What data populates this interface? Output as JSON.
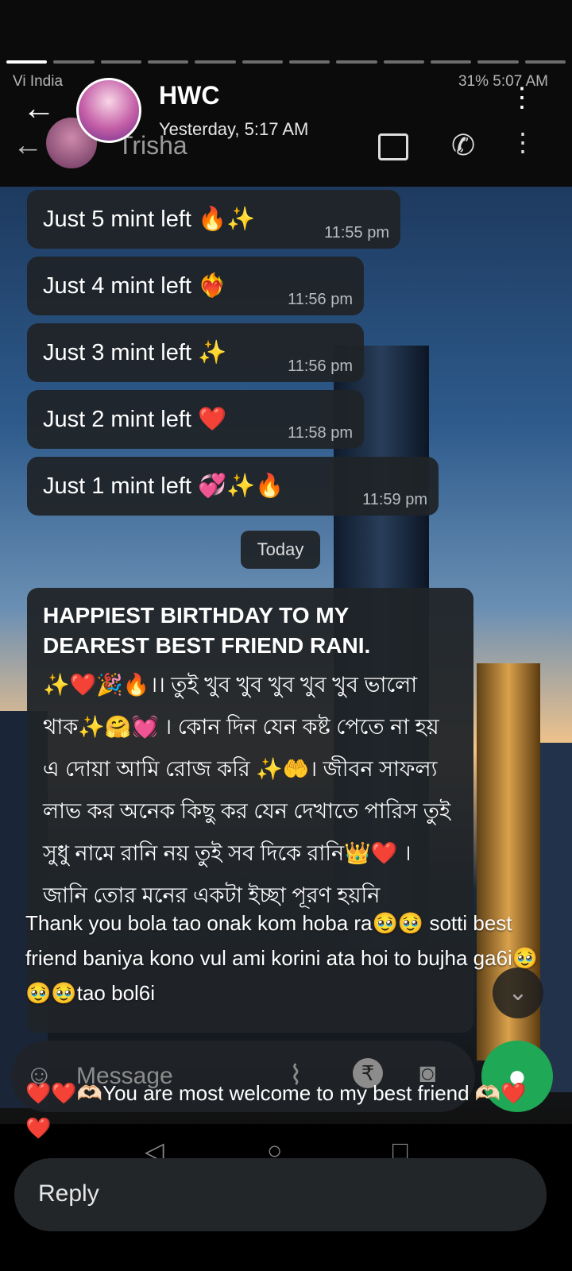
{
  "story": {
    "progress_total": 12,
    "progress_current": 1,
    "title": "HWC",
    "subtitle": "Yesterday, 5:17 AM",
    "status_left": "Vi India",
    "status_right": "31% 5:07 AM",
    "under_name": "Trisha"
  },
  "chat": {
    "messages": [
      {
        "text": "Just 5 mint left 🔥✨",
        "time": "11:55 pm"
      },
      {
        "text": "Just 4 mint left ❤️‍🔥",
        "time": "11:56 pm"
      },
      {
        "text": "Just 3 mint left ✨",
        "time": "11:56 pm"
      },
      {
        "text": "Just 2 mint left ❤️",
        "time": "11:58 pm"
      },
      {
        "text": "Just 1 mint left 💞✨🔥",
        "time": "11:59 pm"
      }
    ],
    "date_chip": "Today",
    "birthday": {
      "heading": "HAPPIEST BIRTHDAY TO MY DEAREST BEST FRIEND RANI.",
      "body": "✨❤️🎉🔥।। তুই খুব খুব খুব খুব খুব ভালো থাক✨🤗💓 । কোন দিন যেন কষ্ট পেতে না হয় এ দোয়া আমি রোজ করি ✨🤲। জীবন সাফল্য লাভ কর অনেক কিছু কর যেন দেখাতে পারিস তুই সুধু নামে রানি নয় তুই সব দিকে রানি👑❤️ । জানি তোর মনের একটা ইচ্ছা পূরণ হয়নি"
    },
    "composer_placeholder": "Message"
  },
  "overlay": {
    "reply_text": "Thank you bola tao onak kom hoba ra🥹🥹 sotti best friend baniya kono vul ami korini ata hoi to bujha ga6i🥹🥹🥹tao bol6i",
    "welcome_text": "❤️❤️🫶🏻You are most welcome to my best friend 🫶🏻❤️❤️"
  },
  "reply_box": {
    "placeholder": "Reply"
  }
}
